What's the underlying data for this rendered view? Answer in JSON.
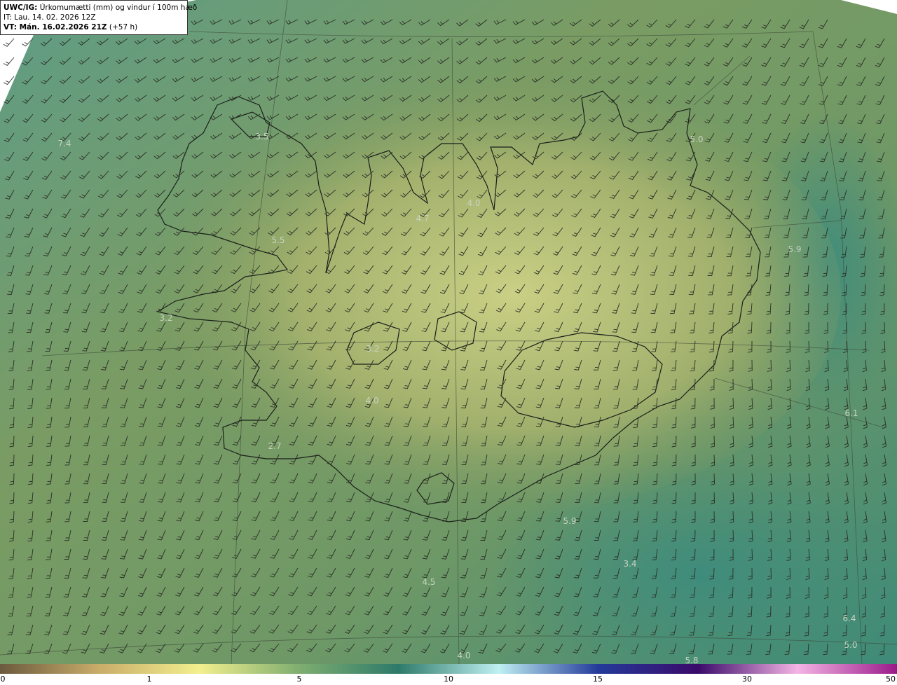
{
  "header": {
    "product_prefix": "UWC/IG:",
    "product_title": " Úrkomumætti (mm) og vindur í 100m hæð",
    "issue_time": "IT: Lau. 14. 02. 2026 12Z",
    "valid_prefix": "VT: Mán. 16.02.2026 21Z",
    "valid_suffix": " (+57 h)"
  },
  "value_labels": [
    "3.5",
    "7.4",
    "4.7",
    "4.0",
    "5.0",
    "5.5",
    "5.9",
    "3.2",
    "3.2",
    "4.0",
    "2.7",
    "6.1",
    "5.9",
    "3.4",
    "4.5",
    "6.4",
    "5.0",
    "4.0",
    "5.8"
  ],
  "colorbar": {
    "ticks": [
      "0",
      "1",
      "5",
      "10",
      "15",
      "30",
      "50"
    ],
    "colors": [
      "#6b5a3e",
      "#c9ad6a",
      "#f3ef8e",
      "#7fae70",
      "#2e7a6a",
      "#bff0f2",
      "#243a9a",
      "#3a0a6a",
      "#f4b4e4",
      "#9a1a8a"
    ]
  }
}
